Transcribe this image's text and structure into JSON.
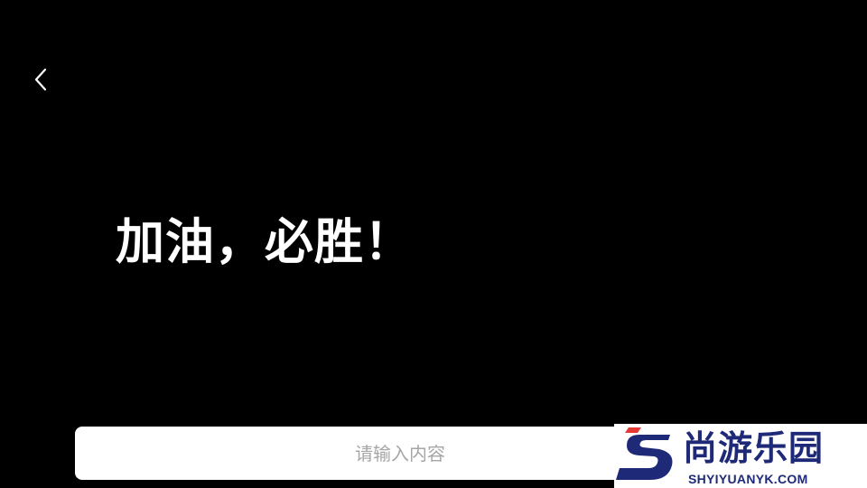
{
  "header": {
    "back_icon": "chevron-left-icon"
  },
  "display": {
    "text": "加油，必胜！",
    "text_color": "#ffffff",
    "background_color": "#000000"
  },
  "input": {
    "value": "",
    "placeholder": "请输入内容"
  },
  "watermark": {
    "title": "尚游乐园",
    "domain": "SHYIYUANYK.COM",
    "brand_color": "#1e2a78",
    "accent_color": "#e53935"
  }
}
